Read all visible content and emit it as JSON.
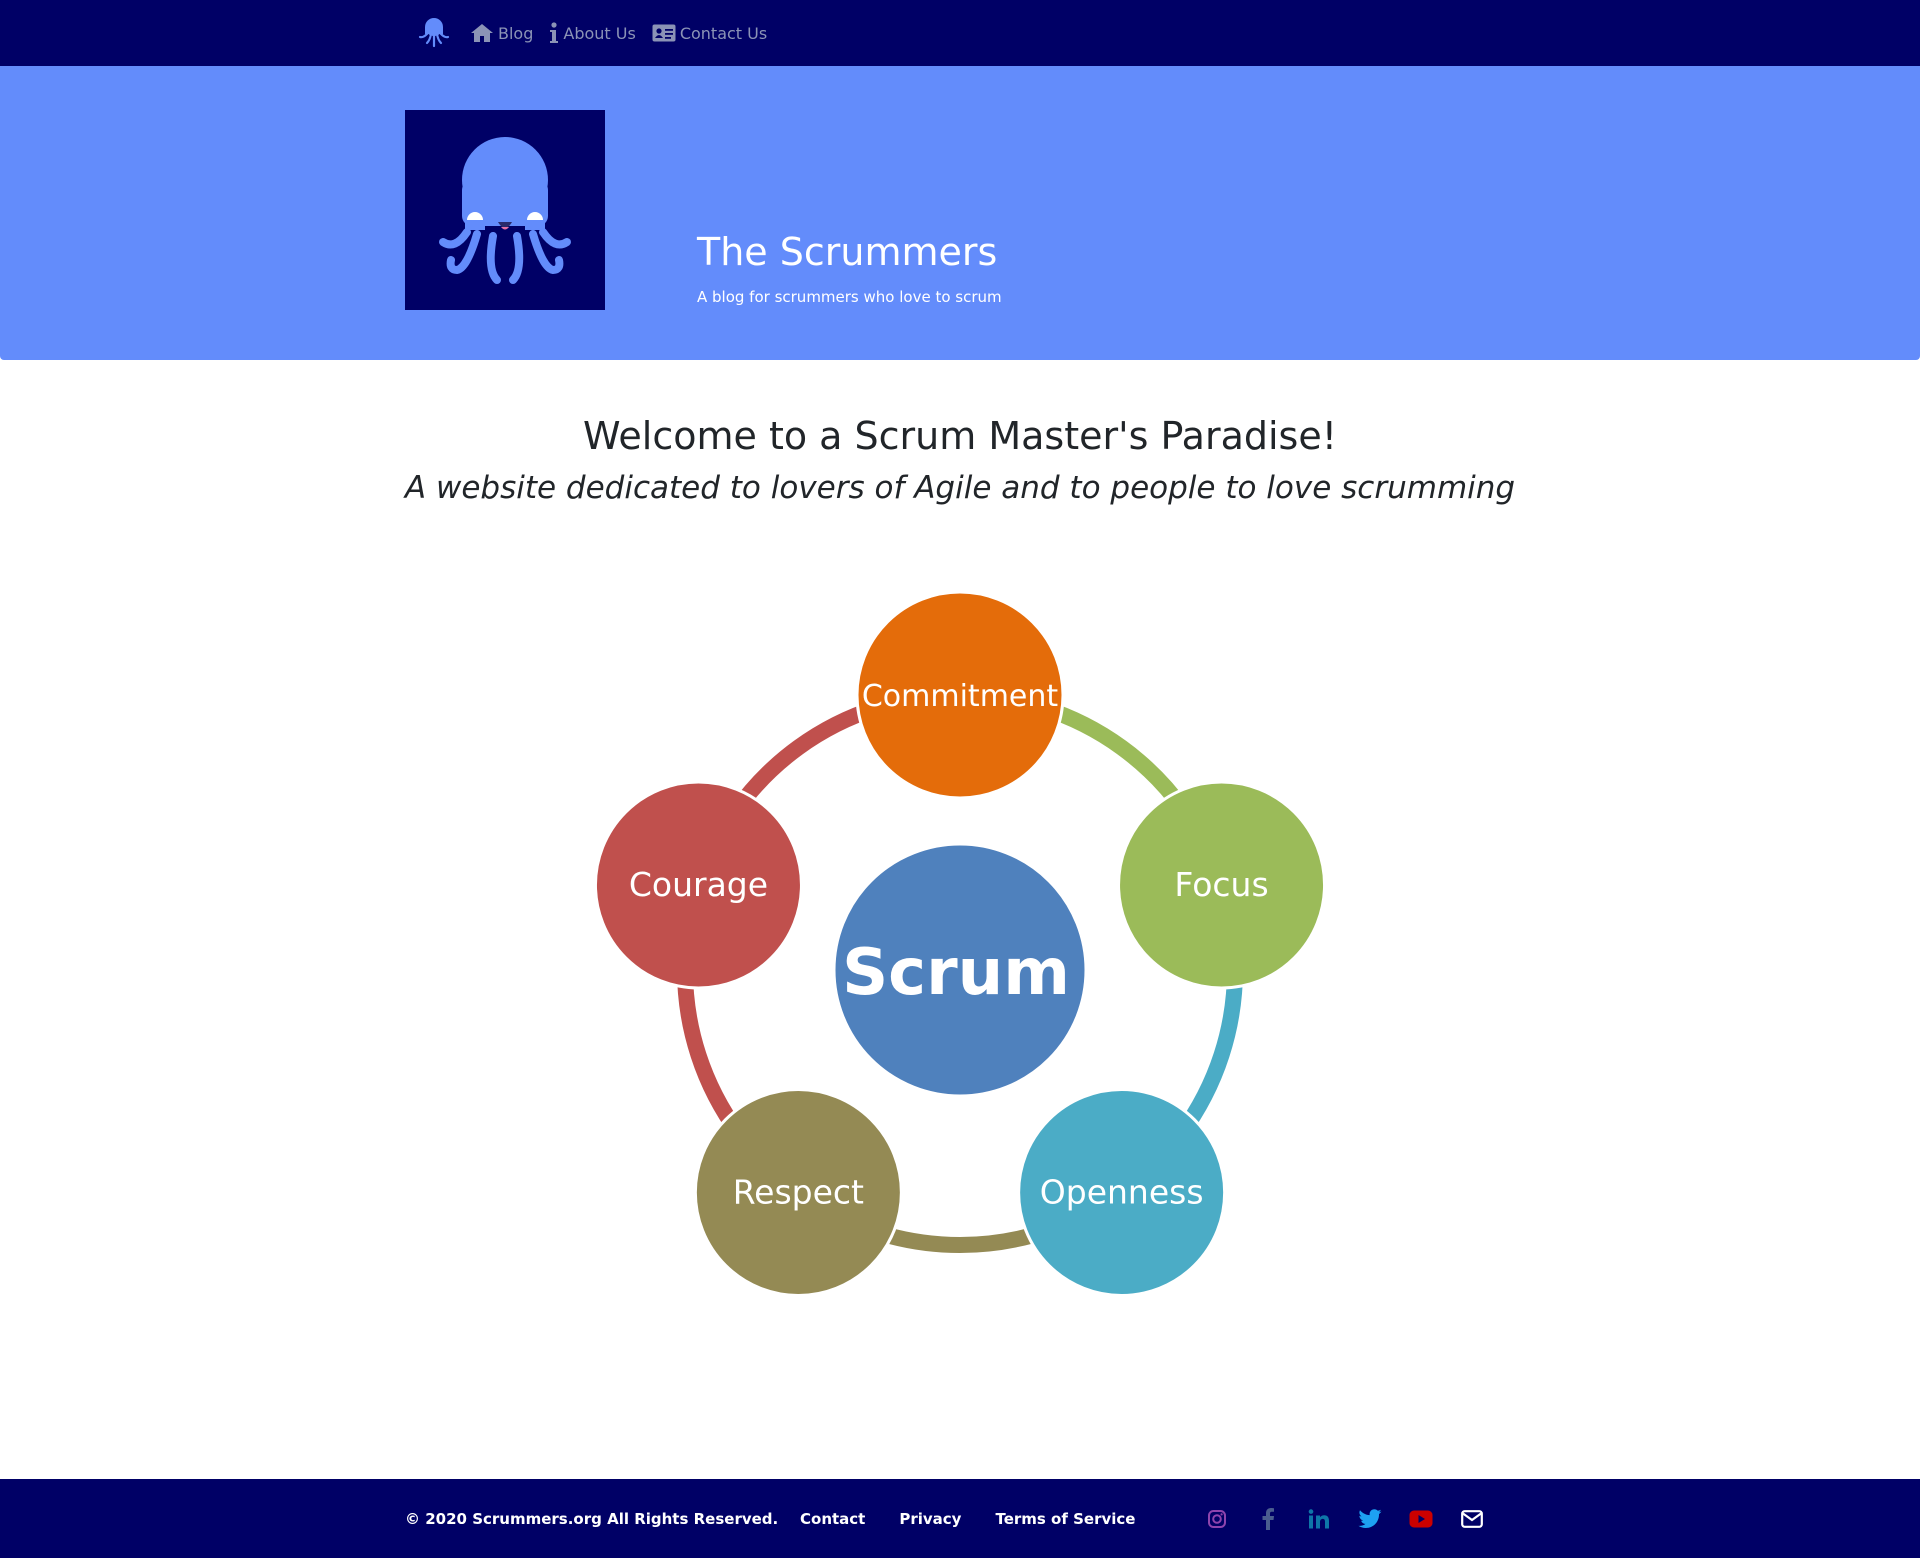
{
  "nav": {
    "brand_icon": "octopus-icon",
    "links": [
      {
        "label": "Blog",
        "icon": "home-icon"
      },
      {
        "label": "About Us",
        "icon": "info-icon"
      },
      {
        "label": "Contact Us",
        "icon": "contact-card-icon"
      }
    ]
  },
  "hero": {
    "logo_icon": "octopus-logo",
    "title": "The Scrummers",
    "subtitle": "A blog for scrummers who love to scrum"
  },
  "welcome": {
    "title": "Welcome to a Scrum Master's Paradise!",
    "subtitle": "A website dedicated to lovers of Agile and to people to love scrumming"
  },
  "diagram": {
    "center": {
      "label": "Scrum",
      "color": "#4f81bd"
    },
    "values": [
      {
        "label": "Commitment",
        "color": "#e46c0a"
      },
      {
        "label": "Focus",
        "color": "#9bbb59"
      },
      {
        "label": "Openness",
        "color": "#4bacc6"
      },
      {
        "label": "Respect",
        "color": "#948a54"
      },
      {
        "label": "Courage",
        "color": "#c0504d"
      }
    ]
  },
  "footer": {
    "copyright": "© 2020 Scrummers.org All Rights Reserved.",
    "links": [
      "Contact",
      "Privacy",
      "Terms of Service"
    ],
    "social": [
      {
        "icon": "instagram-icon",
        "color": "#8e44ad"
      },
      {
        "icon": "facebook-icon",
        "color": "#4a5d8f"
      },
      {
        "icon": "linkedin-icon",
        "color": "#0e76a8"
      },
      {
        "icon": "twitter-icon",
        "color": "#1da1f2"
      },
      {
        "icon": "youtube-icon",
        "color": "#cc0000"
      },
      {
        "icon": "envelope-icon",
        "color": "#ffffff"
      }
    ]
  },
  "colors": {
    "navbar": "#000066",
    "hero": "#638cfb",
    "footer": "#000066"
  }
}
